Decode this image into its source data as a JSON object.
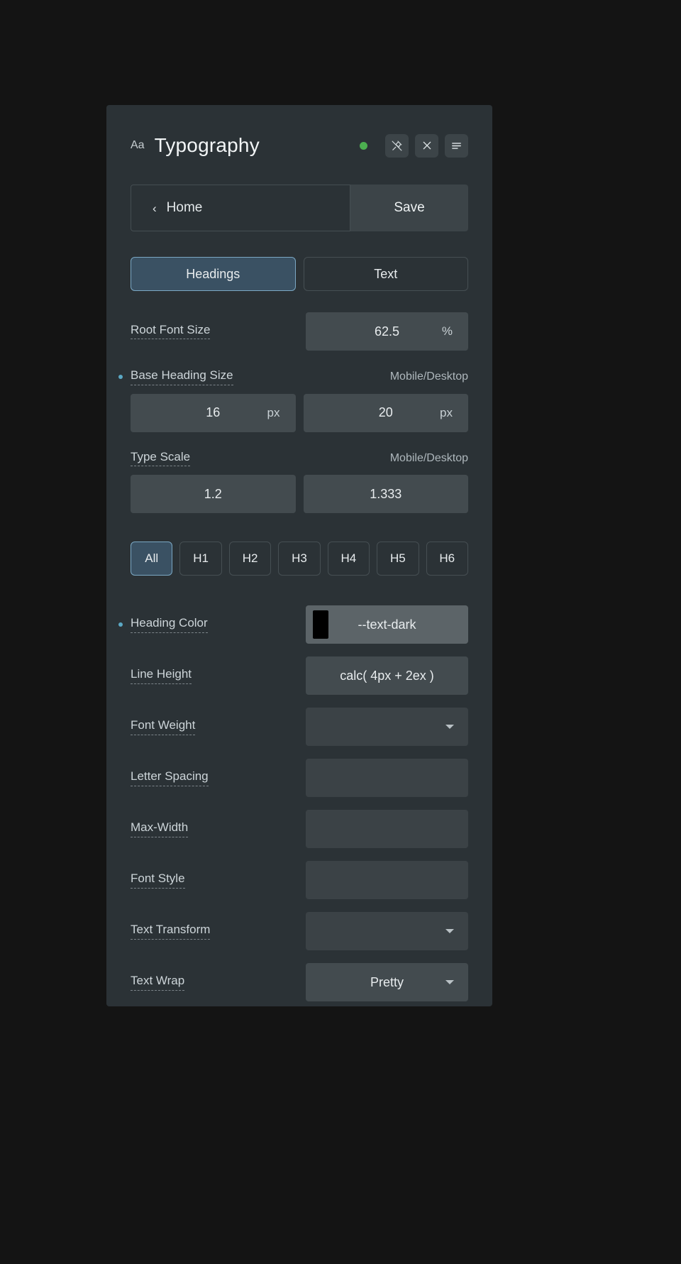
{
  "header": {
    "icon_label": "Aa",
    "title": "Typography",
    "status": "active",
    "buttons": [
      {
        "name": "pin-off-icon",
        "label": ""
      },
      {
        "name": "close-icon",
        "label": ""
      },
      {
        "name": "menu-icon",
        "label": ""
      }
    ]
  },
  "nav": {
    "back_label": "Home",
    "back_chevron": "‹",
    "save_label": "Save"
  },
  "tabs": [
    {
      "label": "Headings",
      "active": true
    },
    {
      "label": "Text",
      "active": false
    }
  ],
  "fields": {
    "root_font_size": {
      "label": "Root Font Size",
      "value": "62.5",
      "unit": "%"
    },
    "base_heading_size": {
      "label": "Base Heading Size",
      "caption": "Mobile/Desktop",
      "mobile_value": "16",
      "mobile_unit": "px",
      "desktop_value": "20",
      "desktop_unit": "px"
    },
    "type_scale": {
      "label": "Type Scale",
      "caption": "Mobile/Desktop",
      "mobile_value": "1.2",
      "desktop_value": "1.333"
    },
    "heading_color": {
      "label": "Heading Color",
      "value": "--text-dark",
      "swatch_color": "#000000"
    },
    "line_height": {
      "label": "Line Height",
      "value": "calc( 4px + 2ex )"
    },
    "font_weight": {
      "label": "Font Weight",
      "value": ""
    },
    "letter_spacing": {
      "label": "Letter Spacing",
      "value": ""
    },
    "max_width": {
      "label": "Max-Width",
      "value": ""
    },
    "font_style": {
      "label": "Font Style",
      "value": ""
    },
    "text_transform": {
      "label": "Text Transform",
      "value": ""
    },
    "text_wrap": {
      "label": "Text Wrap",
      "value": "Pretty"
    }
  },
  "heading_levels": [
    {
      "label": "All",
      "active": true
    },
    {
      "label": "H1",
      "active": false
    },
    {
      "label": "H2",
      "active": false
    },
    {
      "label": "H3",
      "active": false
    },
    {
      "label": "H4",
      "active": false
    },
    {
      "label": "H5",
      "active": false
    },
    {
      "label": "H6",
      "active": false
    }
  ],
  "colors": {
    "panel_bg": "#2b3236",
    "page_bg": "#141414",
    "accent": "#7ba8c4",
    "accent_bullet": "#5ba8c4",
    "status_green": "#4caf50",
    "input_bg": "#434b4f"
  }
}
